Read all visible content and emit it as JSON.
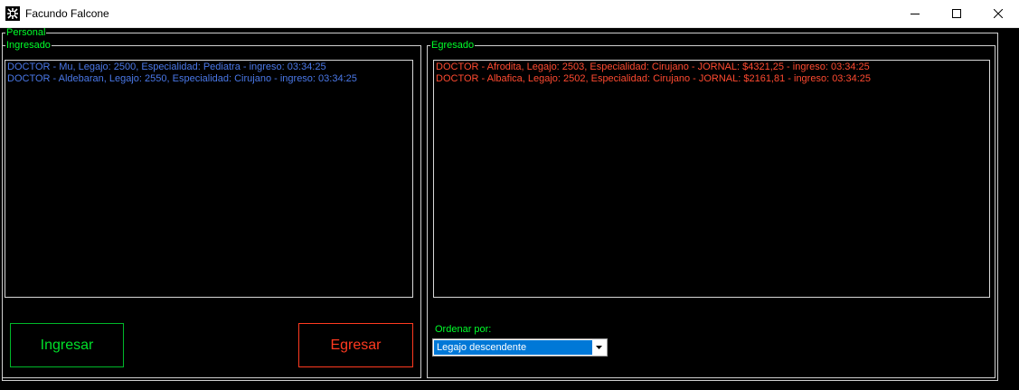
{
  "window": {
    "title": "Facundo Falcone"
  },
  "groups": {
    "personal": "Personal",
    "ingresado": "Ingresado",
    "egresado": "Egresado"
  },
  "ingresado_list": [
    "DOCTOR - Mu, Legajo: 2500, Especialidad: Pediatra - ingreso: 03:34:25",
    "DOCTOR - Aldebaran, Legajo: 2550, Especialidad: Cirujano - ingreso: 03:34:25"
  ],
  "egresado_list": [
    "DOCTOR - Afrodita, Legajo: 2503, Especialidad: Cirujano - JORNAL: $4321,25 - ingreso: 03:34:25",
    "DOCTOR - Albafica, Legajo: 2502, Especialidad: Cirujano - JORNAL: $2161,81 - ingreso: 03:34:25"
  ],
  "buttons": {
    "ingresar": "Ingresar",
    "egresar": "Egresar"
  },
  "order": {
    "label": "Ordenar por:",
    "selected": "Legajo descendente"
  },
  "colors": {
    "background": "#000000",
    "legend_text": "#00ff2a",
    "ingresado_items": "#4a78e8",
    "egresado_items": "#ff4a30",
    "select_highlight": "#0078d7"
  }
}
